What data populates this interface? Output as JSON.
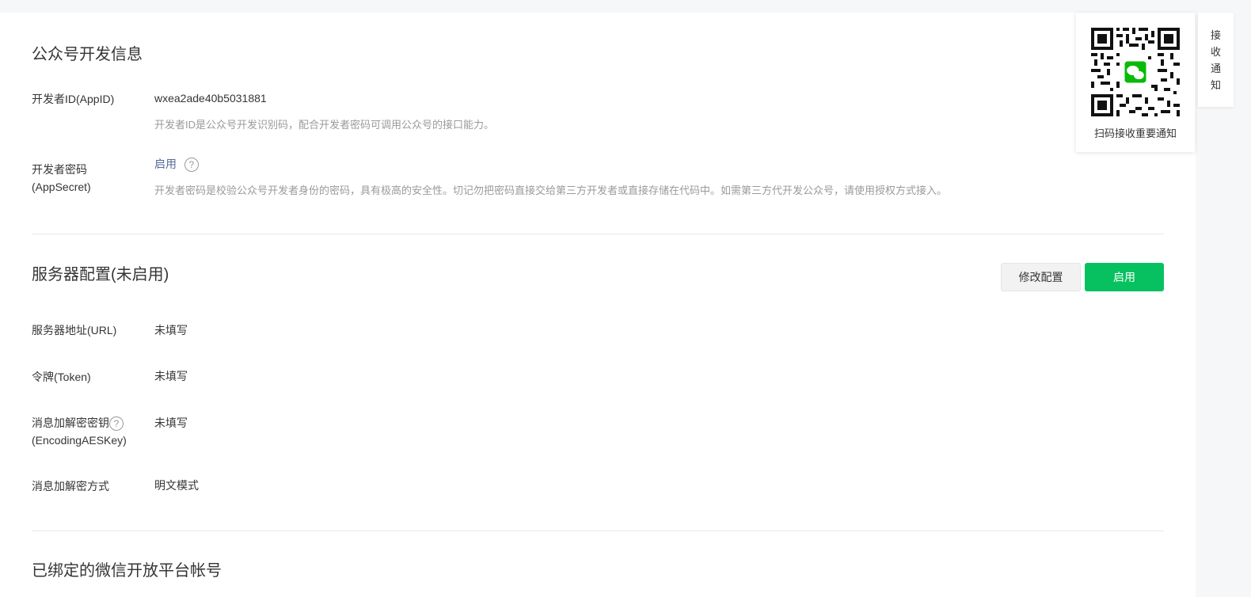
{
  "dev_info": {
    "title": "公众号开发信息",
    "appid_label": "开发者ID(AppID)",
    "appid_value": "wxea2ade40b5031881",
    "appid_desc": "开发者ID是公众号开发识别码，配合开发者密码可调用公众号的接口能力。",
    "secret_label": "开发者密码(AppSecret)",
    "secret_link": "启用",
    "secret_help": "?",
    "secret_desc": "开发者密码是校验公众号开发者身份的密码，具有极高的安全性。切记勿把密码直接交给第三方开发者或直接存储在代码中。如需第三方代开发公众号，请使用授权方式接入。"
  },
  "server_config": {
    "title": "服务器配置(未启用)",
    "modify_button": "修改配置",
    "enable_button": "启用",
    "url_label": "服务器地址(URL)",
    "url_value": "未填写",
    "token_label": "令牌(Token)",
    "token_value": "未填写",
    "aes_label_line1": "消息加解密密钥",
    "aes_label_line2": "(EncodingAESKey)",
    "aes_help": "?",
    "aes_value": "未填写",
    "mode_label": "消息加解密方式",
    "mode_value": "明文模式"
  },
  "bound_accounts": {
    "title": "已绑定的微信开放平台帐号"
  },
  "qr_panel": {
    "caption": "扫码接收重要通知",
    "icon": "wechat-qr-code"
  },
  "side_tab": {
    "chars": [
      "接",
      "收",
      "通",
      "知"
    ]
  },
  "colors": {
    "primary": "#07c160",
    "link": "#576b95",
    "muted": "#9a9a9a"
  }
}
